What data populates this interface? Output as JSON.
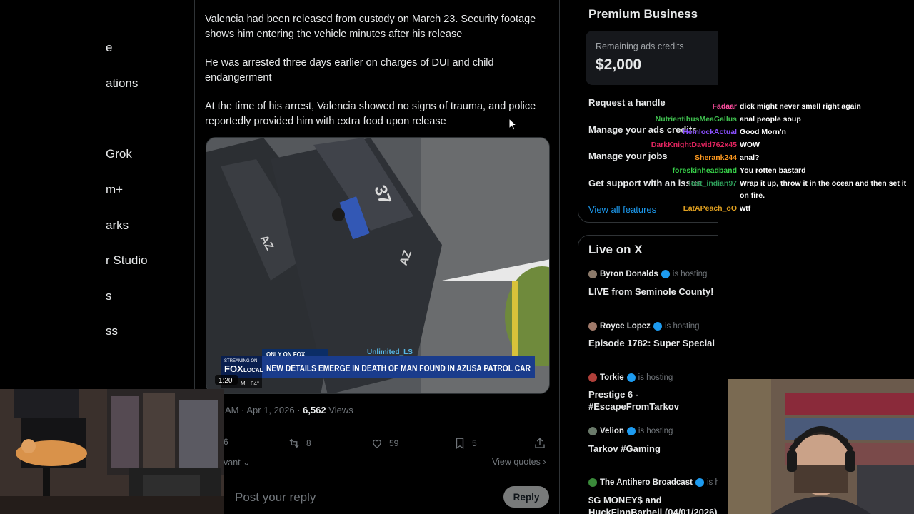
{
  "leftnav": {
    "items": [
      "e",
      "ations",
      "Grok",
      "m+",
      "arks",
      "r Studio",
      "s",
      "ss"
    ]
  },
  "post": {
    "paragraphs": [
      "Valencia had been released from custody on March 23. Security footage shows him entering the vehicle minutes after his release",
      "He was arrested three days earlier on charges of DUI and child endangerment",
      "At the time of his arrest, Valencia showed no signs of trauma, and police reportedly provided him with extra food upon release"
    ],
    "video": {
      "banner_small": "ONLY ON FOX",
      "headline": "NEW DETAILS EMERGE IN DEATH OF MAN FOUND IN AZUSA PATROL CAR",
      "logo_top": "STREAMING ON",
      "logo_main": "FOX",
      "logo_sub": "LOCAL",
      "duration": "1:20",
      "time_partial": "M",
      "temp": "64°",
      "watermark": "Unlimited_LS",
      "car_number": "37",
      "car_mark_a": "AZ",
      "car_mark_b": "AZ"
    },
    "meta_time": "AM · Apr 1, 2026 ·",
    "meta_views_count": "6,562",
    "meta_views_label": "Views",
    "actions": {
      "replies": "6",
      "reposts": "8",
      "likes": "59",
      "bookmarks": "5"
    },
    "relevant_label": "vant",
    "view_quotes": "View quotes",
    "reply_placeholder": "Post your reply",
    "reply_button": "Reply"
  },
  "sidebar": {
    "premium_title": "Premium Business",
    "credits_label": "Remaining ads credits",
    "credits_value": "$2,000",
    "links": [
      "Request a handle",
      "Manage your ads credits",
      "Manage your jobs",
      "Get support with an issue"
    ],
    "view_all": "View all features",
    "live_title": "Live on X",
    "hosting_label": "is hosting",
    "live": [
      {
        "host": "Byron Donalds",
        "title": "LIVE from Seminole County!"
      },
      {
        "host": "Royce Lopez",
        "title": "Episode 1782: Super Special"
      },
      {
        "host": "Torkie",
        "title": "Prestige 6 - #EscapeFromTarkov"
      },
      {
        "host": "Velion",
        "title": "Tarkov #Gaming"
      },
      {
        "host": "The Antihero Broadcast",
        "title": "$G MONEY$ and HuckFinnBarbell (04/01/2026)"
      }
    ]
  },
  "chat": [
    {
      "user": "Fadaar",
      "color": "#ff4fa0",
      "msg": "dick might never smell right again"
    },
    {
      "user": "NutrientibusMeaGallus",
      "color": "#3fbf4f",
      "msg": "anal people soup"
    },
    {
      "user": "HemlockActual",
      "color": "#8a4fff",
      "msg": "Good Morn'n"
    },
    {
      "user": "DarkKnightDavid762x45",
      "color": "#e0245e",
      "msg": "WOW"
    },
    {
      "user": "Sherank244",
      "color": "#ff9a1f",
      "msg": "anal?"
    },
    {
      "user": "foreskinheadband",
      "color": "#38d14a",
      "msg": "You rotten bastard"
    },
    {
      "user": "lost_indian97",
      "color": "#2e9e5a",
      "msg": "Wrap it up, throw it in the ocean and then set it on fire."
    },
    {
      "user": "EatAPeach_oO",
      "color": "#e0a020",
      "msg": "wtf"
    }
  ]
}
